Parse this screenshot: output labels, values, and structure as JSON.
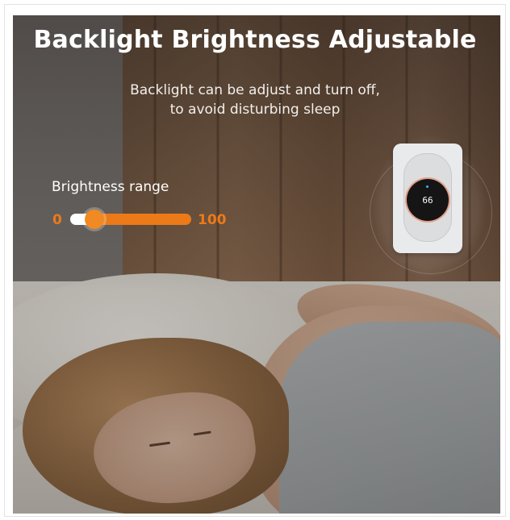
{
  "banner": {
    "title": "Backlight Brightness Adjustable",
    "subtitle_line1": "Backlight can be adjust and turn off,",
    "subtitle_line2": "to avoid disturbing sleep"
  },
  "brightness": {
    "label": "Brightness range",
    "min_label": "0",
    "max_label": "100",
    "current_fraction": 0.2
  },
  "device": {
    "screen_reading": "66"
  },
  "colors": {
    "accent": "#ec7a18",
    "text": "#ffffff"
  }
}
